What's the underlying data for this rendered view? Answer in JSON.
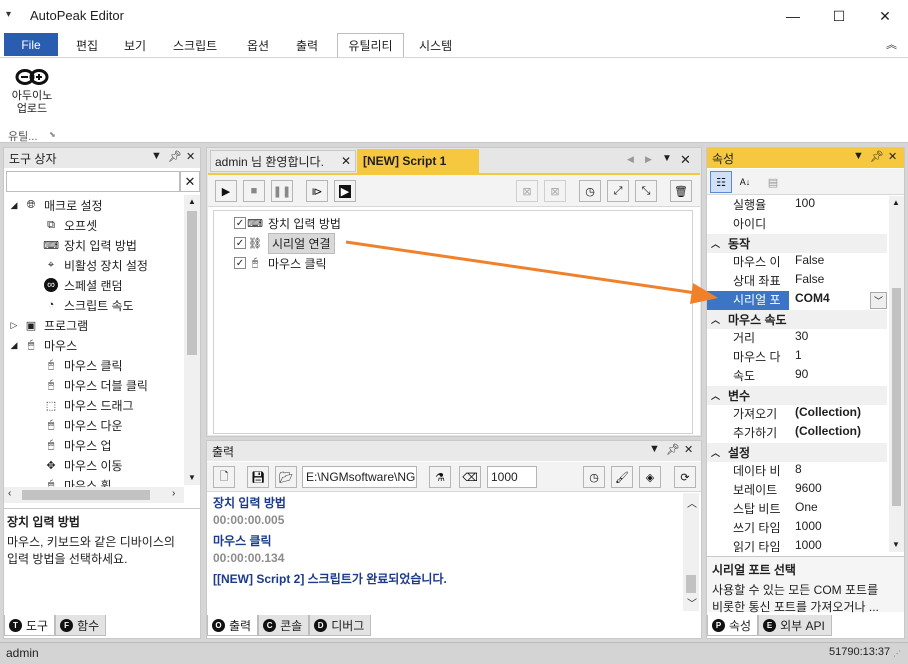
{
  "window": {
    "title": "AutoPeak Editor",
    "menu_glyph": "▾",
    "min": "—",
    "max": "☐",
    "close": "✕"
  },
  "menubar": {
    "file": "File",
    "items": [
      "편집",
      "보기",
      "스크립트",
      "옵션",
      "출력",
      "유틸리티",
      "시스템"
    ],
    "collapse_glyph": "︽"
  },
  "ribbon": {
    "button_label_1": "아두이노",
    "button_label_2": "업로드",
    "group_label": "유틸..."
  },
  "toolbox": {
    "title": "도구 상자",
    "items": [
      {
        "label": "매크로 설정"
      },
      {
        "label": "오프셋"
      },
      {
        "label": "장치 입력 방법"
      },
      {
        "label": "비활성 장치 설정"
      },
      {
        "label": "스페셜 랜덤"
      },
      {
        "label": "스크립트 속도"
      },
      {
        "label": "프로그램"
      },
      {
        "label": "마우스"
      },
      {
        "label": "마우스 클릭"
      },
      {
        "label": "마우스 더블 클릭"
      },
      {
        "label": "마우스 드래그"
      },
      {
        "label": "마우스 다운"
      },
      {
        "label": "마우스 업"
      },
      {
        "label": "마우스 이동"
      },
      {
        "label": "마우스 휠"
      }
    ],
    "desc_title": "장치 입력 방법",
    "desc_body_1": "마우스, 키보드와 같은 디바이스의",
    "desc_body_2": "입력 방법을 선택하세요.",
    "tabs": {
      "tools": "도구",
      "functions": "함수"
    }
  },
  "editor": {
    "tab_welcome": "admin 님 환영합니다.",
    "tab_script": "[NEW] Script 1",
    "steps": [
      {
        "label": "장치 입력 방법",
        "checked": true
      },
      {
        "label": "시리얼 연결",
        "checked": true
      },
      {
        "label": "마우스 클릭",
        "checked": true
      }
    ]
  },
  "output": {
    "title": "출력",
    "path": "E:\\NGMsoftware\\NG",
    "count": "1000",
    "lines": [
      {
        "text": "장치 입력 방법",
        "color": "#1b3a8a"
      },
      {
        "text": "00:00:00.005",
        "color": "#8c8c8c"
      },
      {
        "text": "마우스 클릭",
        "color": "#1b3a8a"
      },
      {
        "text": "00:00:00.134",
        "color": "#8c8c8c"
      },
      {
        "text": "[[NEW] Script 2] 스크립트가 완료되었습니다.",
        "color": "#1b3a8a"
      }
    ],
    "tabs": {
      "output": "출력",
      "console": "콘솔",
      "debug": "디버그"
    }
  },
  "properties": {
    "title": "속성",
    "rows": [
      {
        "kind": "row",
        "name": "실행율",
        "value": "100"
      },
      {
        "kind": "row",
        "name": "아이디",
        "value": ""
      },
      {
        "kind": "cat",
        "name": "동작"
      },
      {
        "kind": "row",
        "name": "마우스 이",
        "value": "False"
      },
      {
        "kind": "row",
        "name": "상대 좌표",
        "value": "False"
      },
      {
        "kind": "row",
        "name": "시리얼 포",
        "value": "COM4",
        "selected": true
      },
      {
        "kind": "cat",
        "name": "마우스 속도"
      },
      {
        "kind": "row",
        "name": "거리",
        "value": "30"
      },
      {
        "kind": "row",
        "name": "마우스 다",
        "value": "1"
      },
      {
        "kind": "row",
        "name": "속도",
        "value": "90"
      },
      {
        "kind": "cat",
        "name": "변수"
      },
      {
        "kind": "row",
        "name": "가져오기",
        "value": "(Collection)",
        "bold": true
      },
      {
        "kind": "row",
        "name": "추가하기",
        "value": "(Collection)",
        "bold": true
      },
      {
        "kind": "cat",
        "name": "설정"
      },
      {
        "kind": "row",
        "name": "데이타 비",
        "value": "8"
      },
      {
        "kind": "row",
        "name": "보레이트",
        "value": "9600"
      },
      {
        "kind": "row",
        "name": "스탑 비트",
        "value": "One"
      },
      {
        "kind": "row",
        "name": "쓰기 타임",
        "value": "1000"
      },
      {
        "kind": "row",
        "name": "읽기 타임",
        "value": "1000"
      }
    ],
    "desc_title": "시리얼 포트 선택",
    "desc_body_1": "사용할 수 있는 모든 COM 포트를",
    "desc_body_2": "비롯한 통신 포트를 가져오거나 ...",
    "tabs": {
      "props": "속성",
      "api": "외부 API"
    }
  },
  "status": {
    "user": "admin",
    "time": "51790:13:37"
  },
  "colors": {
    "accent": "#2a5db0",
    "active_header": "#f6c83f",
    "arrow": "#f0802a",
    "selection": "#3b75c4"
  }
}
